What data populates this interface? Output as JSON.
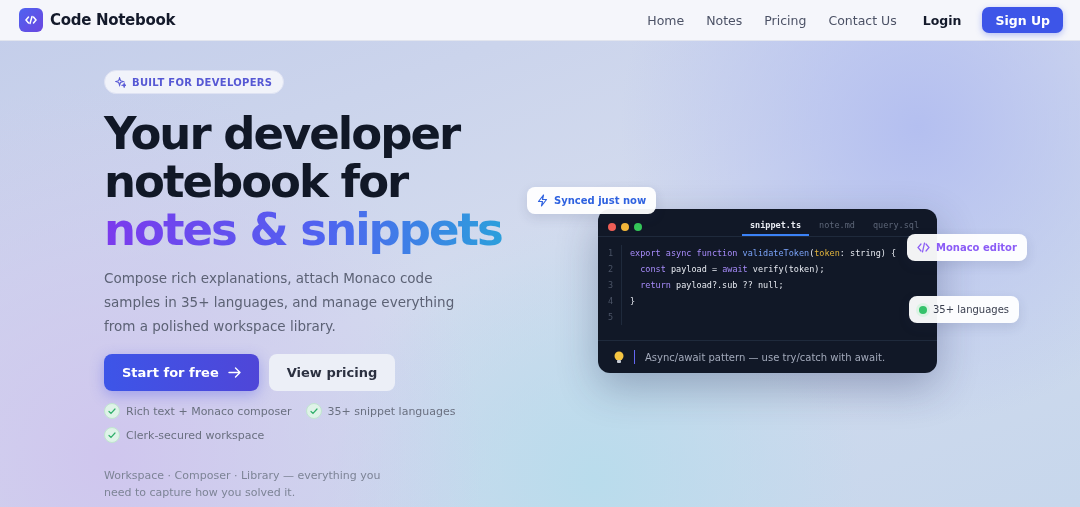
{
  "header": {
    "brand": "Code Notebook",
    "nav": [
      {
        "label": "Home",
        "kind": "link"
      },
      {
        "label": "Notes",
        "kind": "link"
      },
      {
        "label": "Pricing",
        "kind": "link"
      },
      {
        "label": "Contact Us",
        "kind": "link"
      },
      {
        "label": "Login",
        "kind": "strong"
      },
      {
        "label": "Sign Up",
        "kind": "primary"
      }
    ]
  },
  "hero": {
    "badge": "BUILT FOR DEVELOPERS",
    "headline": [
      {
        "text": "Your developer",
        "kind": "plain"
      },
      {
        "text": "notebook for",
        "kind": "plain"
      },
      {
        "text": "notes & snippets",
        "kind": "gradient"
      }
    ],
    "description": "Compose rich explanations, attach Monaco code samples in 35+ languages, and manage everything from a polished workspace library.",
    "buttons": [
      {
        "label": "Start for free",
        "kind": "primary"
      },
      {
        "label": "View pricing",
        "kind": "secondary"
      }
    ],
    "features": [
      "Rich text + Monaco composer",
      "35+ snippet languages",
      "Clerk-secured workspace"
    ],
    "footnote": "Workspace · Composer · Library — everything you need to capture how you solved it."
  },
  "editor": {
    "tabs": [
      {
        "label": "snippet.ts",
        "selected": true
      },
      {
        "label": "note.md",
        "selected": false
      },
      {
        "label": "query.sql",
        "selected": false
      }
    ],
    "lines": [
      {
        "number": "1",
        "tokens": [
          {
            "text": "export async function ",
            "kind": "keyword"
          },
          {
            "text": "validateToken",
            "kind": "function"
          },
          {
            "text": "(",
            "kind": "plain"
          },
          {
            "text": "token",
            "kind": "param"
          },
          {
            "text": ": string) {",
            "kind": "plain"
          }
        ]
      },
      {
        "number": "2",
        "tokens": [
          {
            "text": "  const ",
            "kind": "keyword"
          },
          {
            "text": "payload = ",
            "kind": "plain"
          },
          {
            "text": "await ",
            "kind": "keyword"
          },
          {
            "text": "verify(token);",
            "kind": "plain"
          }
        ]
      },
      {
        "number": "3",
        "tokens": [
          {
            "text": "  return ",
            "kind": "keyword"
          },
          {
            "text": "payload?.sub ?? null;",
            "kind": "plain"
          }
        ]
      },
      {
        "number": "4",
        "tokens": [
          {
            "text": "}",
            "kind": "plain"
          }
        ]
      },
      {
        "number": "5"
      }
    ],
    "tip": "Async/await pattern — use try/catch with await."
  },
  "chips": [
    {
      "label": "Synced just now",
      "kind": "synced"
    },
    {
      "label": "Monaco editor",
      "kind": "monaco"
    },
    {
      "label": "35+ languages",
      "kind": "languages"
    }
  ]
}
